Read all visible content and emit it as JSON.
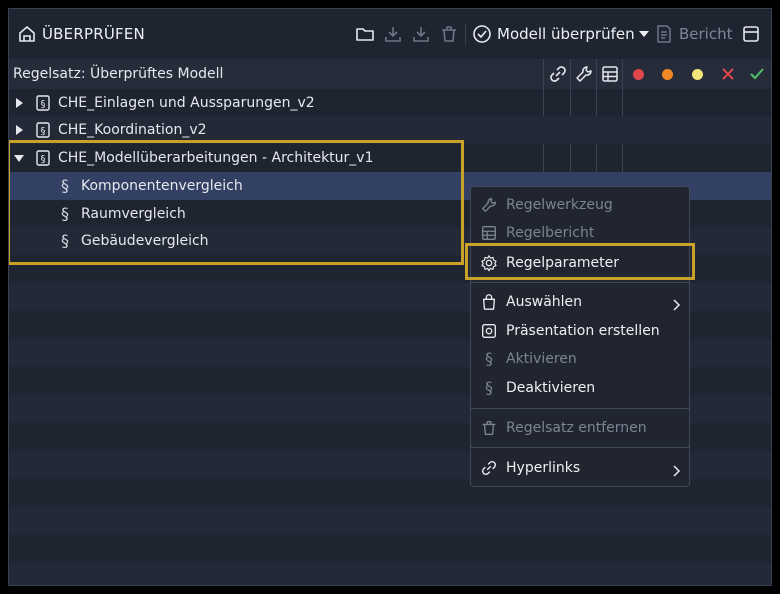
{
  "title": "ÜBERPRÜFEN",
  "toolbar": {
    "check_model_label": "Modell überprüfen",
    "report_label": "Bericht"
  },
  "header": {
    "ruleset_label": "Regelsatz: Überprüftes Modell"
  },
  "status_colors": {
    "red": "#e0474c",
    "orange": "#f08a24",
    "yellow": "#f2e27a",
    "fail": "#e0474c",
    "pass": "#4fbf6a"
  },
  "tree": {
    "items": [
      {
        "label": "CHE_Einlagen und Aussparungen_v2",
        "expanded": false
      },
      {
        "label": "CHE_Koordination_v2",
        "expanded": false
      },
      {
        "label": "CHE_Modellüberarbeitungen - Architektur_v1",
        "expanded": true
      }
    ],
    "children": [
      {
        "symbol": "§",
        "label": "Komponentenvergleich"
      },
      {
        "symbol": "§",
        "label": "Raumvergleich"
      },
      {
        "symbol": "§",
        "label": "Gebäudevergleich"
      }
    ]
  },
  "context_menu": {
    "items": [
      {
        "label": "Regelwerkzeug",
        "icon": "wrench-icon",
        "enabled": false
      },
      {
        "label": "Regelbericht",
        "icon": "table-icon",
        "enabled": false
      },
      {
        "label": "Regelparameter",
        "icon": "gear-icon",
        "enabled": true
      },
      {
        "label": "Auswählen",
        "icon": "bag-icon",
        "enabled": true
      },
      {
        "label": "Präsentation erstellen",
        "icon": "presentation-icon",
        "enabled": true
      },
      {
        "label": "Aktivieren",
        "icon": "paragraph-icon",
        "enabled": false
      },
      {
        "label": "Deaktivieren",
        "icon": "paragraph-icon",
        "enabled": true
      },
      {
        "label": "Regelsatz entfernen",
        "icon": "trash-icon",
        "enabled": false
      },
      {
        "label": "Hyperlinks",
        "icon": "link-icon",
        "enabled": true
      }
    ]
  },
  "highlight_color": "#c9a227"
}
